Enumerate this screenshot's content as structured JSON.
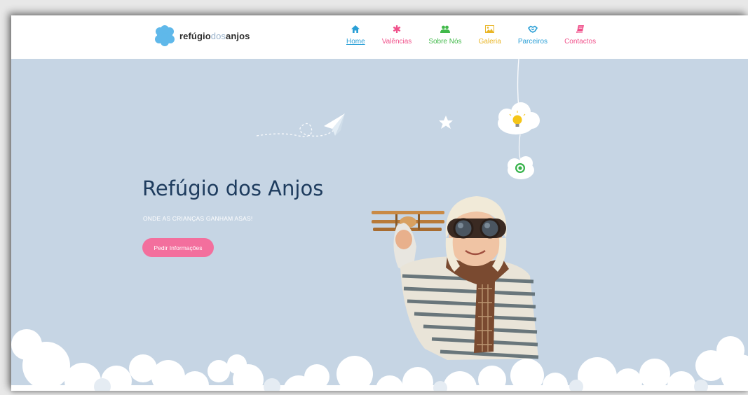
{
  "header": {
    "logo_parts": {
      "part1": "refúgio",
      "part2": "dos",
      "part3": "anjos"
    }
  },
  "nav": {
    "items": [
      {
        "label": "Home",
        "icon": "home-icon",
        "color": "#2a9fd6"
      },
      {
        "label": "Valências",
        "icon": "asterisk-icon",
        "color": "#f0508a"
      },
      {
        "label": "Sobre Nós",
        "icon": "users-icon",
        "color": "#41b94a"
      },
      {
        "label": "Galeria",
        "icon": "picture-icon",
        "color": "#e9b526"
      },
      {
        "label": "Parceiros",
        "icon": "handshake-icon",
        "color": "#2a9fd6"
      },
      {
        "label": "Contactos",
        "icon": "book-icon",
        "color": "#f0508a"
      }
    ]
  },
  "hero": {
    "title": "Refúgio dos Anjos",
    "subtitle": "ONDE AS CRIANÇAS GANHAM ASAS!",
    "button_label": "Pedir Informações"
  },
  "colors": {
    "background": "#c6d5e4",
    "accent_pink": "#f36f9d",
    "title_navy": "#1e3c5e"
  }
}
